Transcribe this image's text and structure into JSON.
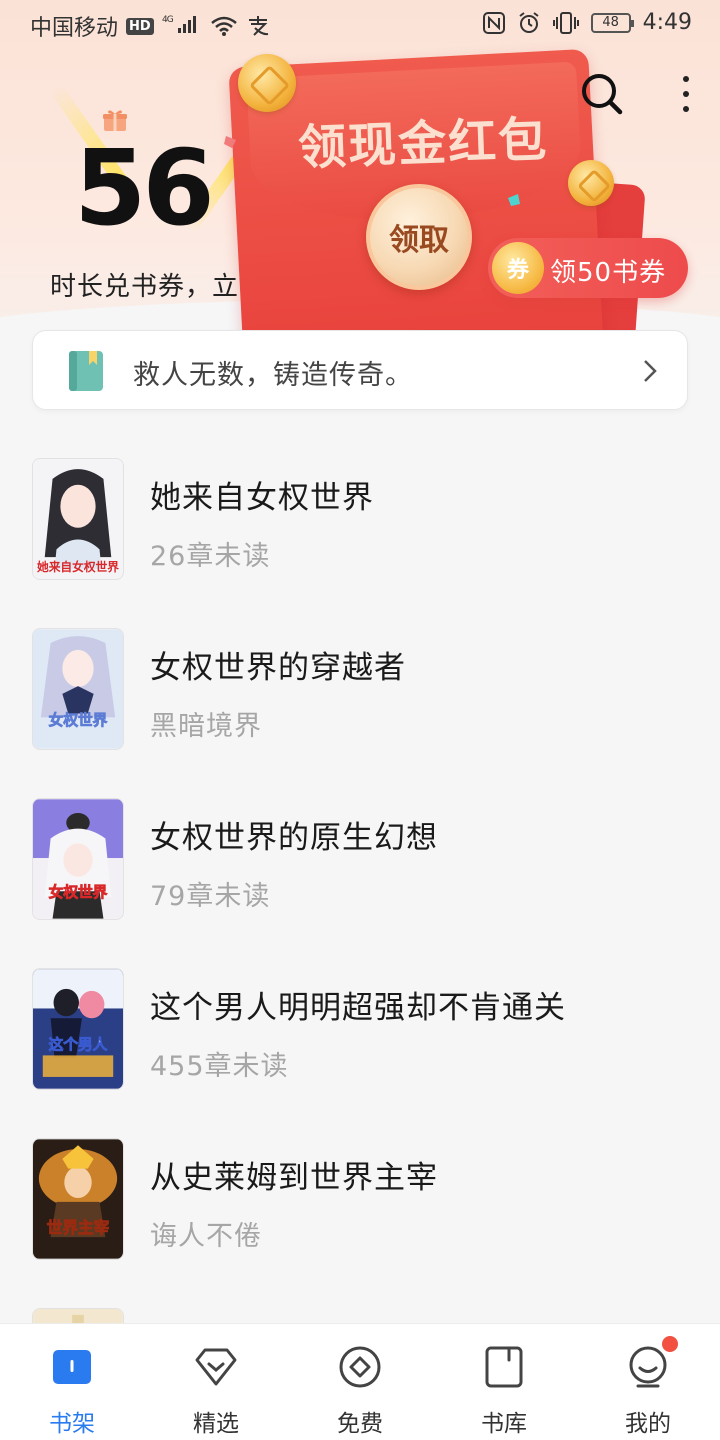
{
  "status_bar": {
    "carrier": "中国移动",
    "hd": "HD",
    "network": "4G",
    "battery": "48",
    "time": "4:49"
  },
  "header": {
    "reading_minutes": "56",
    "exchange_link": "时长兑书券，立即兑换 >",
    "envelope_title": "领现金红包",
    "claim_button": "领取",
    "voucher_symbol": "券",
    "voucher_label": "领50书券"
  },
  "quote_banner": {
    "text": "救人无数，铸造传奇。"
  },
  "books": [
    {
      "title": "她来自女权世界",
      "subtitle": "26章未读",
      "cover_text": "她来自女权世界"
    },
    {
      "title": "女权世界的穿越者",
      "subtitle": "黑暗境界",
      "cover_text": "女权世界"
    },
    {
      "title": "女权世界的原生幻想",
      "subtitle": "79章未读",
      "cover_text": "女权世界"
    },
    {
      "title": "这个男人明明超强却不肯通关",
      "subtitle": "455章未读",
      "cover_text": "这个男人"
    },
    {
      "title": "从史莱姆到世界主宰",
      "subtitle": "诲人不倦",
      "cover_text": "世界主宰"
    }
  ],
  "tabs": [
    {
      "label": "书架",
      "icon": "bookshelf-icon",
      "active": true
    },
    {
      "label": "精选",
      "icon": "diamond-icon",
      "active": false
    },
    {
      "label": "免费",
      "icon": "free-icon",
      "active": false
    },
    {
      "label": "书库",
      "icon": "library-icon",
      "active": false
    },
    {
      "label": "我的",
      "icon": "profile-icon",
      "active": false,
      "badge": true
    }
  ],
  "colors": {
    "accent": "#2b7bf0",
    "envelope_red": "#e8423c",
    "badge_red": "#f25040",
    "muted_text": "#a6a6a6"
  }
}
